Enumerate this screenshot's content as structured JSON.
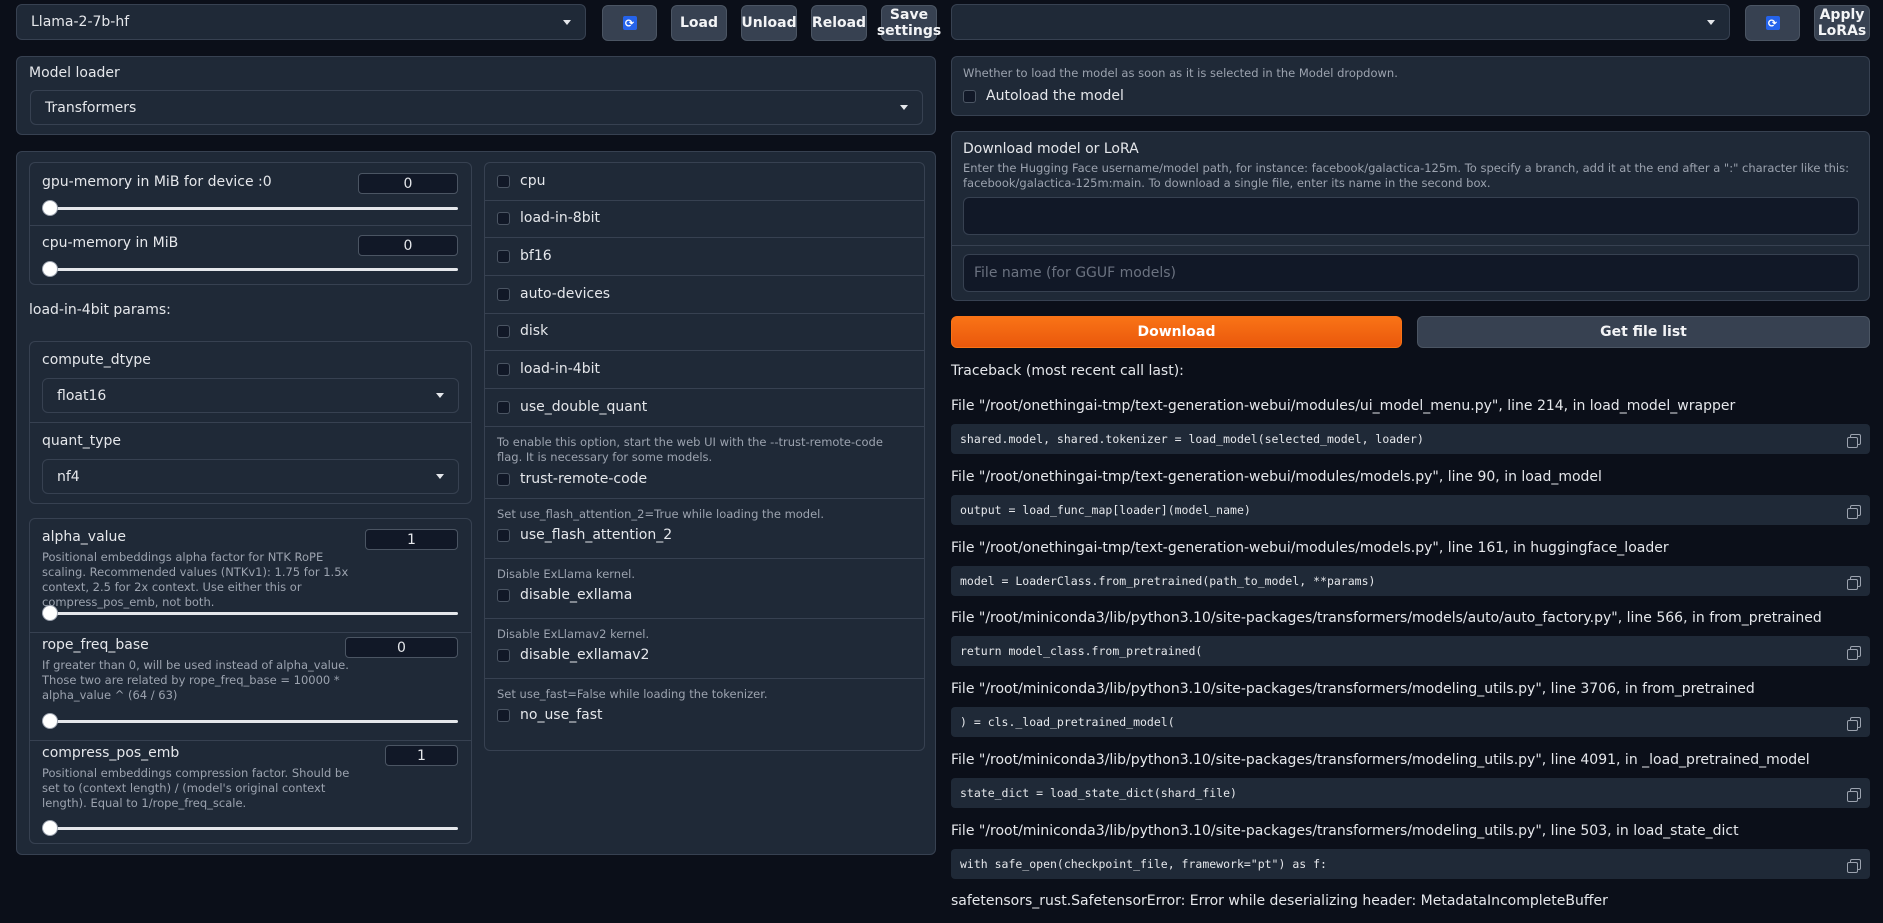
{
  "top": {
    "model_select": "Llama-2-7b-hf",
    "load_label": "Load",
    "unload_label": "Unload",
    "reload_label": "Reload",
    "save_settings_label": "Save settings",
    "lora_select": "",
    "apply_loras_label": "Apply LoRAs"
  },
  "loader": {
    "label": "Model loader",
    "value": "Transformers"
  },
  "sliders": {
    "gpu_memory": {
      "label": "gpu-memory in MiB for device :0",
      "value": "0",
      "fraction": 0
    },
    "cpu_memory": {
      "label": "cpu-memory in MiB",
      "value": "0",
      "fraction": 0
    },
    "alpha_value": {
      "label": "alpha_value",
      "value": "1",
      "fraction": 0,
      "info": "Positional embeddings alpha factor for NTK RoPE scaling. Recommended values (NTKv1): 1.75 for 1.5x context, 2.5 for 2x context. Use either this or compress_pos_emb, not both."
    },
    "rope_freq_base": {
      "label": "rope_freq_base",
      "value": "0",
      "fraction": 0,
      "info": "If greater than 0, will be used instead of alpha_value. Those two are related by rope_freq_base = 10000 * alpha_value ^ (64 / 63)"
    },
    "compress_pos_emb": {
      "label": "compress_pos_emb",
      "value": "1",
      "fraction": 0,
      "info": "Positional embeddings compression factor. Should be set to (context length) / (model's original context length). Equal to 1/rope_freq_scale."
    }
  },
  "fourbit": {
    "heading": "load-in-4bit params:",
    "compute_dtype_label": "compute_dtype",
    "compute_dtype_value": "float16",
    "quant_type_label": "quant_type",
    "quant_type_value": "nf4"
  },
  "checkboxes": {
    "cpu": "cpu",
    "load_in_8bit": "load-in-8bit",
    "bf16": "bf16",
    "auto_devices": "auto-devices",
    "disk": "disk",
    "load_in_4bit": "load-in-4bit",
    "use_double_quant": "use_double_quant",
    "trust_remote_code_info": "To enable this option, start the web UI with the --trust-remote-code flag. It is necessary for some models.",
    "trust_remote_code": "trust-remote-code",
    "flash_attention_info": "Set use_flash_attention_2=True while loading the model.",
    "use_flash_attention_2": "use_flash_attention_2",
    "exllama_info": "Disable ExLlama kernel.",
    "disable_exllama": "disable_exllama",
    "exllamav2_info": "Disable ExLlamav2 kernel.",
    "disable_exllamav2": "disable_exllamav2",
    "fast_info": "Set use_fast=False while loading the tokenizer.",
    "no_use_fast": "no_use_fast"
  },
  "autoload": {
    "info": "Whether to load the model as soon as it is selected in the Model dropdown.",
    "label": "Autoload the model"
  },
  "download": {
    "title": "Download model or LoRA",
    "info": "Enter the Hugging Face username/model path, for instance: facebook/galactica-125m. To specify a branch, add it at the end after a \":\" character like this: facebook/galactica-125m:main. To download a single file, enter its name in the second box.",
    "path_value": "",
    "filename_placeholder": "File name (for GGUF models)",
    "download_label": "Download",
    "file_list_label": "Get file list"
  },
  "traceback": {
    "header": "Traceback (most recent call last):",
    "frames": [
      {
        "file": "File \"/root/onethingai-tmp/text-generation-webui/modules/ui_model_menu.py\", line 214, in load_model_wrapper",
        "code": "shared.model, shared.tokenizer = load_model(selected_model, loader)"
      },
      {
        "file": "File \"/root/onethingai-tmp/text-generation-webui/modules/models.py\", line 90, in load_model",
        "code": "output = load_func_map[loader](model_name)"
      },
      {
        "file": "File \"/root/onethingai-tmp/text-generation-webui/modules/models.py\", line 161, in huggingface_loader",
        "code": "model = LoaderClass.from_pretrained(path_to_model, **params)"
      },
      {
        "file": "File \"/root/miniconda3/lib/python3.10/site-packages/transformers/models/auto/auto_factory.py\", line 566, in from_pretrained",
        "code": "return model_class.from_pretrained("
      },
      {
        "file": "File \"/root/miniconda3/lib/python3.10/site-packages/transformers/modeling_utils.py\", line 3706, in from_pretrained",
        "code": ") = cls._load_pretrained_model("
      },
      {
        "file": "File \"/root/miniconda3/lib/python3.10/site-packages/transformers/modeling_utils.py\", line 4091, in _load_pretrained_model",
        "code": "state_dict = load_state_dict(shard_file)"
      },
      {
        "file": "File \"/root/miniconda3/lib/python3.10/site-packages/transformers/modeling_utils.py\", line 503, in load_state_dict",
        "code": "with safe_open(checkpoint_file, framework=\"pt\") as f:"
      }
    ],
    "error": "safetensors_rust.SafetensorError: Error while deserializing header: MetadataIncompleteBuffer"
  },
  "colors": {
    "background": "#0b0f19",
    "panel": "#1f2937",
    "primary": "#f97316",
    "refresh": "#2563eb"
  }
}
